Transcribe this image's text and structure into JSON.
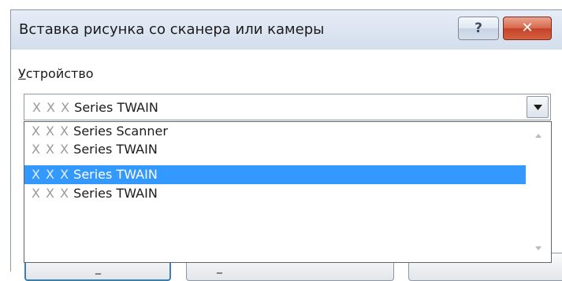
{
  "window": {
    "title": "Вставка рисунка со сканера или камеры",
    "help_label": "?",
    "close_label": "✕"
  },
  "device": {
    "label_underlined": "У",
    "label_rest": "стройство",
    "selected": {
      "prefix": "X X X",
      "name": "Series TWAIN"
    }
  },
  "dropdown": {
    "items": [
      {
        "prefix": "X X X",
        "name": "Series Scanner",
        "selected": false
      },
      {
        "prefix": "X X X",
        "name": "Series TWAIN",
        "selected": false
      },
      {
        "prefix": "X X X",
        "name": "Series TWAIN",
        "selected": true
      },
      {
        "prefix": "X X X",
        "name": "Series TWAIN",
        "selected": false
      }
    ]
  },
  "buttons": {
    "left_label": "_",
    "mid_label": "_"
  },
  "colors": {
    "selection": "#3399ff",
    "dialog_bg": "#dce5f0",
    "close_button": "#c4432a"
  }
}
